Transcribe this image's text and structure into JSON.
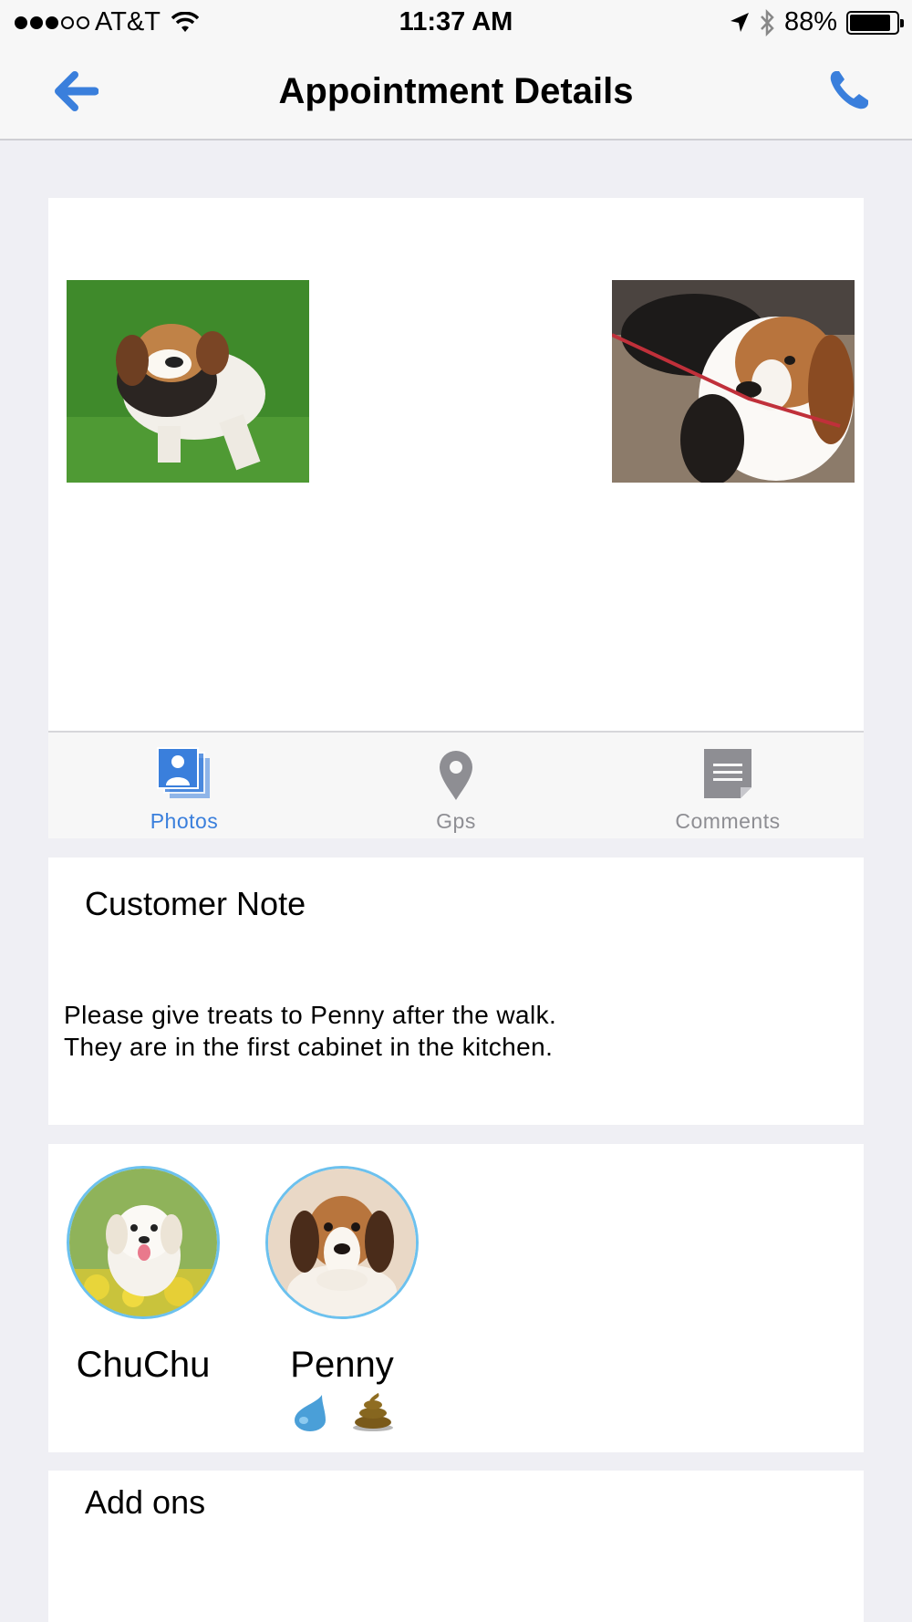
{
  "status_bar": {
    "carrier": "AT&T",
    "time": "11:37 AM",
    "battery_percent": "88%",
    "battery_level": 0.88
  },
  "nav": {
    "title": "Appointment Details",
    "back_icon": "back-arrow-icon",
    "call_icon": "phone-icon"
  },
  "photos": [
    {
      "icon": "dog-photo-1"
    },
    {
      "icon": "dog-photo-2"
    }
  ],
  "tabs": [
    {
      "label": "Photos",
      "icon": "photos-icon",
      "active": true
    },
    {
      "label": "Gps",
      "icon": "map-pin-icon",
      "active": false
    },
    {
      "label": "Comments",
      "icon": "comments-icon",
      "active": false
    }
  ],
  "customer_note": {
    "title": "Customer Note",
    "line1": "Please give treats to Penny after the walk.",
    "line2": "They are in the first cabinet in the kitchen."
  },
  "pets": [
    {
      "name": "ChuChu",
      "icons": []
    },
    {
      "name": "Penny",
      "icons": [
        "water-drop-icon",
        "poop-icon"
      ]
    }
  ],
  "addons": {
    "title": "Add ons"
  },
  "colors": {
    "accent": "#3a7fdc",
    "background": "#efeff4",
    "avatar_border": "#6cc1ee"
  }
}
